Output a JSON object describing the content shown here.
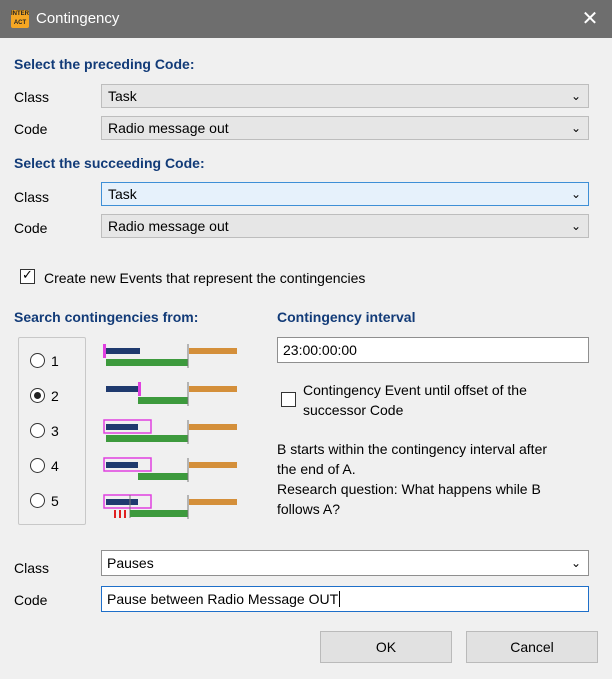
{
  "window": {
    "title": "Contingency",
    "icon_text": "INTER ACT",
    "close": "✕"
  },
  "preceding": {
    "heading": "Select the preceding Code:",
    "class_label": "Class",
    "class_value": "Task",
    "code_label": "Code",
    "code_value": "Radio message out"
  },
  "succeeding": {
    "heading": "Select the succeeding Code:",
    "class_label": "Class",
    "class_value": "Task",
    "code_label": "Code",
    "code_value": "Radio message out"
  },
  "create_events": {
    "label": "Create new Events that represent the contingencies",
    "checked": true
  },
  "search": {
    "heading": "Search contingencies from:",
    "options": [
      {
        "label": "1",
        "selected": false
      },
      {
        "label": "2",
        "selected": true
      },
      {
        "label": "3",
        "selected": false
      },
      {
        "label": "4",
        "selected": false
      },
      {
        "label": "5",
        "selected": false
      }
    ]
  },
  "interval": {
    "heading": "Contingency interval",
    "value": "23:00:00:00",
    "offset_checkbox_label_line1": "Contingency Event until offset of the",
    "offset_checkbox_label_line2": "successor Code",
    "offset_checked": false,
    "description_line1": "B starts within the contingency interval after",
    "description_line2": "the end of A.",
    "description_line3": "Research question: What happens while B",
    "description_line4": "follows A?"
  },
  "result": {
    "class_label": "Class",
    "class_value": "Pauses",
    "code_label": "Code",
    "code_value": "Pause between Radio Message OUT"
  },
  "buttons": {
    "ok": "OK",
    "cancel": "Cancel"
  },
  "colors": {
    "heading": "#123b78",
    "bar_a": "#1f3a6e",
    "bar_b": "#3d9a3d",
    "bar_c": "#d48f3a",
    "marker": "#e040e0",
    "tick_red": "#e02020"
  }
}
